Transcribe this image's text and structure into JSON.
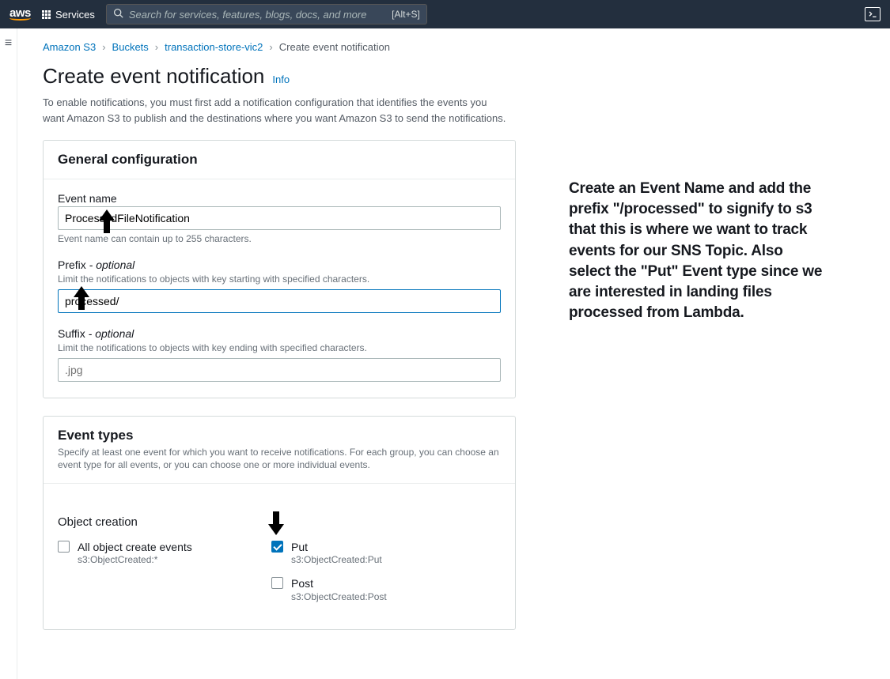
{
  "nav": {
    "services_label": "Services",
    "search_placeholder": "Search for services, features, blogs, docs, and more",
    "search_shortcut": "[Alt+S]"
  },
  "breadcrumb": {
    "items": [
      "Amazon S3",
      "Buckets",
      "transaction-store-vic2"
    ],
    "current": "Create event notification"
  },
  "page": {
    "title": "Create event notification",
    "info_label": "Info",
    "subtitle": "To enable notifications, you must first add a notification configuration that identifies the events you want Amazon S3 to publish and the destinations where you want Amazon S3 to send the notifications."
  },
  "general": {
    "heading": "General configuration",
    "event_name_label": "Event name",
    "event_name_value": "ProcessedFileNotification",
    "event_name_hint": "Event name can contain up to 255 characters.",
    "prefix_label": "Prefix",
    "optional_text": " - optional",
    "prefix_hint": "Limit the notifications to objects with key starting with specified characters.",
    "prefix_value": "processed/",
    "suffix_label": "Suffix",
    "suffix_hint": "Limit the notifications to objects with key ending with specified characters.",
    "suffix_placeholder": ".jpg"
  },
  "events": {
    "heading": "Event types",
    "description": "Specify at least one event for which you want to receive notifications. For each group, you can choose an event type for all events, or you can choose one or more individual events.",
    "object_creation_title": "Object creation",
    "all_create_label": "All object create events",
    "all_create_sub": "s3:ObjectCreated:*",
    "put_label": "Put",
    "put_sub": "s3:ObjectCreated:Put",
    "post_label": "Post",
    "post_sub": "s3:ObjectCreated:Post"
  },
  "side_note": "Create an Event Name and add the prefix \"/processed\" to signify to s3 that this is where we want to track events for our SNS Topic. Also select the \"Put\" Event type since we are interested in landing files processed from Lambda."
}
